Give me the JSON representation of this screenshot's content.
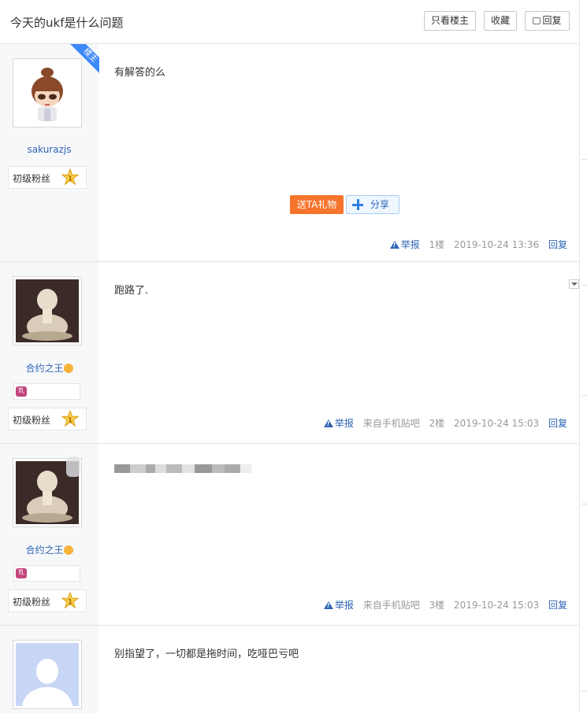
{
  "header": {
    "title": "今天的ukf是什么问题",
    "only_op_label": "只看楼主",
    "favorite_label": "收藏",
    "reply_label": "回复"
  },
  "colors": {
    "link": "#2d64b3",
    "gift": "#f7742c",
    "ribbon": "#3e89fa",
    "sidebar": "#f7f8fa"
  },
  "posts": [
    {
      "username": "sakurazjs",
      "ribbon": "楼主",
      "fan_label": "初级粉丝",
      "fan_level": "1",
      "content": "有解答的么",
      "gift_label": "送TA礼物",
      "share_label": "分享",
      "report_label": "举报",
      "floor": "1楼",
      "time": "2019-10-24 13:36",
      "reply_label": "回复"
    },
    {
      "username": "合约之王",
      "badge": "♏",
      "fan_label": "初级粉丝",
      "fan_level": "1",
      "content": "跑路了.",
      "report_label": "举报",
      "source": "来自手机贴吧",
      "floor": "2楼",
      "time": "2019-10-24 15:03",
      "reply_label": "回复"
    },
    {
      "username": "合约之王",
      "badge": "♏",
      "fan_label": "初级粉丝",
      "fan_level": "1",
      "content_blurred": true,
      "report_label": "举报",
      "source": "来自手机贴吧",
      "floor": "3楼",
      "time": "2019-10-24 15:03",
      "reply_label": "回复"
    },
    {
      "content": "别指望了，一切都是拖时间，吃哑巴亏吧"
    }
  ]
}
